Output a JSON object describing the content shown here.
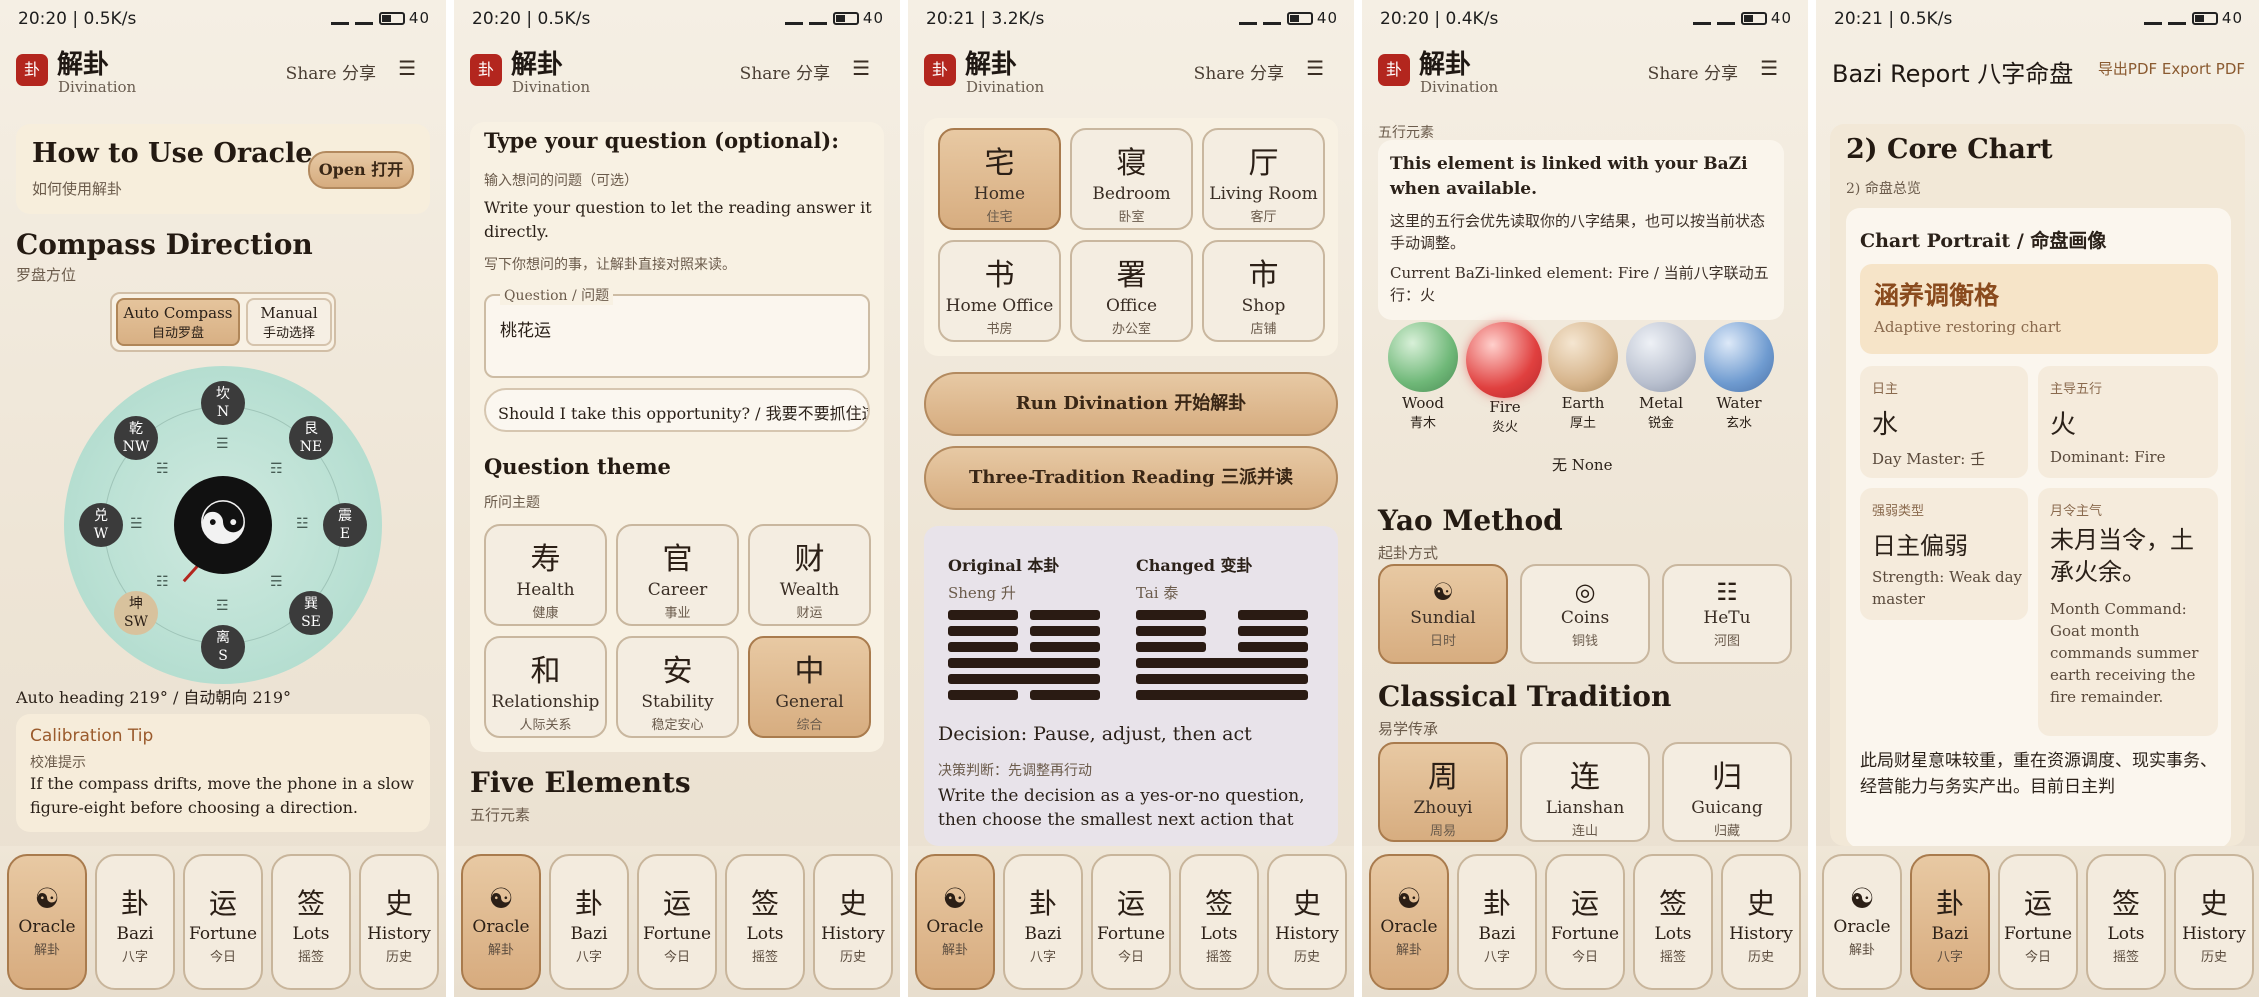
{
  "status": [
    {
      "time": "20:20 | 0.5K/s",
      "battery": "40"
    },
    {
      "time": "20:20 | 0.5K/s",
      "battery": "40"
    },
    {
      "time": "20:21 | 3.2K/s",
      "battery": "40"
    },
    {
      "time": "20:20 | 0.4K/s",
      "battery": "40"
    },
    {
      "time": "20:21 | 0.5K/s",
      "battery": "40"
    }
  ],
  "app": {
    "title": "解卦",
    "subtitle": "Divination",
    "share": "Share 分享",
    "menu_icon": "☰",
    "logo_glyph": "卦"
  },
  "nav": [
    {
      "icon": "☯",
      "en": "Oracle",
      "cn": "解卦"
    },
    {
      "icon": "卦",
      "en": "Bazi",
      "cn": "八字"
    },
    {
      "icon": "运",
      "en": "Fortune",
      "cn": "今日"
    },
    {
      "icon": "签",
      "en": "Lots",
      "cn": "摇签"
    },
    {
      "icon": "史",
      "en": "History",
      "cn": "历史"
    }
  ],
  "p1": {
    "how_title": "How to Use Oracle",
    "how_sub": "如何使用解卦",
    "open_btn": "Open 打开",
    "compass_title": "Compass Direction",
    "compass_sub": "罗盘方位",
    "auto_en": "Auto Compass",
    "auto_cn": "自动罗盘",
    "manual_en": "Manual",
    "manual_cn": "手动选择",
    "dirs": [
      {
        "cn": "坎",
        "en": "N"
      },
      {
        "cn": "艮",
        "en": "NE"
      },
      {
        "cn": "震",
        "en": "E"
      },
      {
        "cn": "巽",
        "en": "SE"
      },
      {
        "cn": "离",
        "en": "S"
      },
      {
        "cn": "坤",
        "en": "SW"
      },
      {
        "cn": "兑",
        "en": "W"
      },
      {
        "cn": "乾",
        "en": "NW"
      }
    ],
    "trigram_symbols": [
      "☰",
      "☶",
      "☳",
      "☴",
      "☲",
      "☷",
      "☱",
      "☵"
    ],
    "center_glyph": "☯",
    "heading": "Auto heading 219° / 自动朝向 219°",
    "calib_title": "Calibration Tip",
    "calib_sub": "校准提示",
    "calib_text": "If the compass drifts, move the phone in a slow figure-eight before choosing a direction."
  },
  "p2": {
    "q_title": "Type your question (optional):",
    "q_sub": "输入想问的问题（可选）",
    "q_desc_en": "Write your question to let the reading answer it directly.",
    "q_desc_cn": "写下你想问的事，让解卦直接对照来读。",
    "q_label": "Question / 问题",
    "q_value": "桃花运",
    "suggestion": "Should I take this opportunity? / 我要不要抓住这个",
    "theme_title": "Question theme",
    "theme_sub": "所问主题",
    "themes": [
      {
        "big": "寿",
        "en": "Health",
        "cn": "健康"
      },
      {
        "big": "官",
        "en": "Career",
        "cn": "事业"
      },
      {
        "big": "财",
        "en": "Wealth",
        "cn": "财运"
      },
      {
        "big": "和",
        "en": "Relationship",
        "cn": "人际关系"
      },
      {
        "big": "安",
        "en": "Stability",
        "cn": "稳定安心"
      },
      {
        "big": "中",
        "en": "General",
        "cn": "综合"
      }
    ],
    "five_title": "Five Elements",
    "five_sub": "五行元素"
  },
  "p3": {
    "places": [
      {
        "big": "宅",
        "en": "Home",
        "cn": "住宅"
      },
      {
        "big": "寝",
        "en": "Bedroom",
        "cn": "卧室"
      },
      {
        "big": "厅",
        "en": "Living Room",
        "cn": "客厅"
      },
      {
        "big": "书",
        "en": "Home Office",
        "cn": "书房"
      },
      {
        "big": "署",
        "en": "Office",
        "cn": "办公室"
      },
      {
        "big": "市",
        "en": "Shop",
        "cn": "店铺"
      }
    ],
    "run_btn": "Run Divination 开始解卦",
    "three_btn": "Three-Tradition Reading 三派并读",
    "orig_label": "Original 本卦",
    "orig_name": "Sheng 升",
    "changed_label": "Changed 变卦",
    "changed_name": "Tai 泰",
    "decision": "Decision: Pause, adjust, then act",
    "decision_cn": "决策判断：先调整再行动",
    "decision_desc": "Write the decision as a yes-or-no question, then choose the smallest next action that"
  },
  "p4": {
    "top_label": "五行元素",
    "tip_title": "This element is linked with your BaZi when available.",
    "tip_cn": "这里的五行会优先读取你的八字结果，也可以按当前状态手动调整。",
    "tip_current": "Current BaZi-linked element: Fire / 当前八字联动五行：火",
    "elements": [
      {
        "en": "Wood",
        "cn": "青木",
        "color": "#6fb878"
      },
      {
        "en": "Fire",
        "cn": "炎火",
        "color": "#e0403f"
      },
      {
        "en": "Earth",
        "cn": "厚土",
        "color": "#d6b48b"
      },
      {
        "en": "Metal",
        "cn": "锐金",
        "color": "#b9c0cf"
      },
      {
        "en": "Water",
        "cn": "玄水",
        "color": "#6f9bd0"
      }
    ],
    "none_label": "无 None",
    "yao_title": "Yao Method",
    "yao_sub": "起卦方式",
    "methods": [
      {
        "icon": "☯",
        "en": "Sundial",
        "cn": "日时"
      },
      {
        "icon": "◎",
        "en": "Coins",
        "cn": "铜钱"
      },
      {
        "icon": "☷",
        "en": "HeTu",
        "cn": "河图"
      }
    ],
    "class_title": "Classical Tradition",
    "class_sub": "易学传承",
    "traditions": [
      {
        "big": "周",
        "en": "Zhouyi",
        "cn": "周易"
      },
      {
        "big": "连",
        "en": "Lianshan",
        "cn": "连山"
      },
      {
        "big": "归",
        "en": "Guicang",
        "cn": "归藏"
      }
    ]
  },
  "p5": {
    "title": "Bazi Report 八字命盘",
    "export": "导出PDF Export PDF",
    "core_title": "2) Core Chart",
    "core_sub": "2) 命盘总览",
    "portrait_title": "Chart Portrait / 命盘画像",
    "portrait_name": "涵养调衡格",
    "portrait_en": "Adaptive restoring chart",
    "cells": [
      {
        "label": "日主",
        "value": "水",
        "desc": "Day Master: 壬"
      },
      {
        "label": "主导五行",
        "value": "火",
        "desc": "Dominant: Fire"
      },
      {
        "label": "强弱类型",
        "value": "日主偏弱",
        "desc": "Strength: Weak day master"
      },
      {
        "label": "月令主气",
        "value": "未月当令，土承火余。",
        "desc": "Month Command: Goat month commands summer earth receiving the fire remainder."
      }
    ],
    "summary": "此局财星意味较重，重在资源调度、现实事务、经营能力与务实产出。目前日主判"
  }
}
